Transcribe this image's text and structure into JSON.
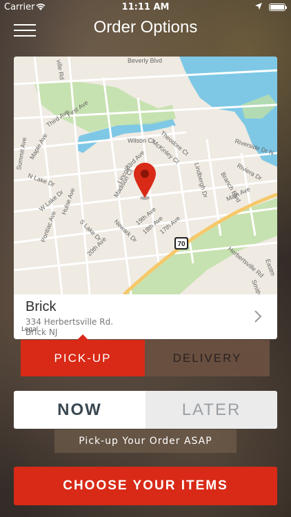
{
  "status_bar": {
    "carrier": "Carrier",
    "time": "11:11 AM"
  },
  "header": {
    "title": "Order Options"
  },
  "map": {
    "legal_label": "Legal",
    "route_badge": "70",
    "street_labels": [
      "Beverly Blvd",
      "First Ave",
      "Third Ave",
      "Wilson Ct",
      "Theodore Ct",
      "McKinley Ct",
      "Riverside Dr N",
      "Riviera Dr",
      "Branch Blvd",
      "Summit Ave",
      "Maple Ave",
      "N Lake Dr",
      "23rd Ave",
      "Lincoln",
      "Madison Ct",
      "Lindbergh Dr",
      "Main Ave",
      "W Lake Dr",
      "Hulse Ave",
      "Pontiac Ave",
      "S Lake Dr",
      "20th Ave",
      "Newark Dr",
      "19th Ave",
      "18th Ave",
      "17th Ave",
      "Herbertsville Rd",
      "Smith",
      "Eastm",
      "ville Rd"
    ]
  },
  "store": {
    "name": "Brick",
    "address_line1": "334 Herbertsville Rd.",
    "address_line2": "Brick NJ"
  },
  "order_type": {
    "pickup_label": "PICK-UP",
    "delivery_label": "DELIVERY",
    "selected": "pickup"
  },
  "timing": {
    "now_label": "NOW",
    "later_label": "LATER",
    "selected": "now",
    "hint": "Pick-up Your Order ASAP"
  },
  "cta": {
    "label": "CHOOSE YOUR ITEMS"
  },
  "colors": {
    "accent_red": "#d82a17",
    "water_blue": "#7ec8e6",
    "park_green": "#bfe0a8"
  }
}
